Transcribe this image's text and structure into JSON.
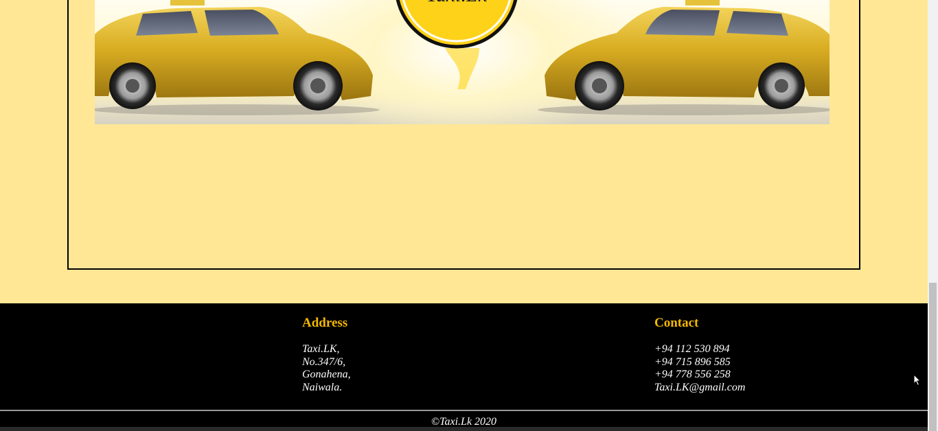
{
  "footer": {
    "address": {
      "heading": "Address",
      "lines": [
        "Taxi.LK,",
        "No.347/6,",
        "Gonahena,",
        "Naiwala."
      ]
    },
    "contact": {
      "heading": "Contact",
      "lines": [
        "+94 112 530 894",
        "+94 715 896 585",
        "+94 778 556 258",
        "Taxi.LK@gmail.com"
      ]
    },
    "copyright": "©Taxi.Lk 2020"
  },
  "banner": {
    "logo_text": "Taxi.Lk"
  },
  "colors": {
    "page_background": "#ffe796",
    "footer_background": "#000000",
    "heading_accent": "#f5b800",
    "car_gold": "#d6ad21"
  }
}
